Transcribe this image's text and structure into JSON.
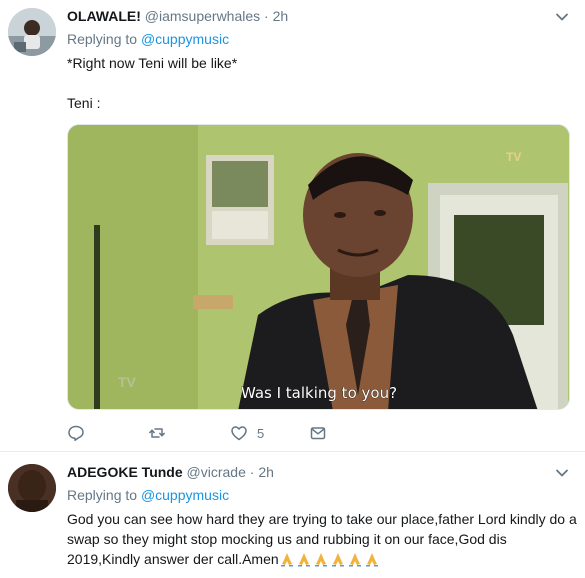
{
  "tweets": [
    {
      "name": "OLAWALE!",
      "handle": "@iamsuperwhales",
      "sep": "·",
      "time": "2h",
      "replying_prefix": "Replying to",
      "replying_to": "@cuppymusic",
      "text_line1": "*Right now Teni will be like*",
      "text_line2": "Teni :",
      "media": {
        "subtitle": "Was I talking to you?",
        "watermark": "TV"
      },
      "actions": {
        "reply_icon": "reply-icon",
        "retweet_icon": "retweet-icon",
        "like_icon": "heart-icon",
        "like_count": "5",
        "dm_icon": "envelope-icon"
      }
    },
    {
      "name": "ADEGOKE Tunde",
      "handle": "@vicrade",
      "sep": "·",
      "time": "2h",
      "replying_prefix": "Replying to",
      "replying_to": "@cuppymusic",
      "text": "God you can see how hard they are trying to take our place,father Lord kindly do a swap so they might stop mocking us and rubbing it on our face,God dis 2019,Kindly answer der call.Amen",
      "emoji": "folded-hands x6"
    }
  ],
  "colors": {
    "link": "#1b95e0",
    "muted": "#657786",
    "text": "#14171a",
    "divider": "#e6ecf0"
  }
}
